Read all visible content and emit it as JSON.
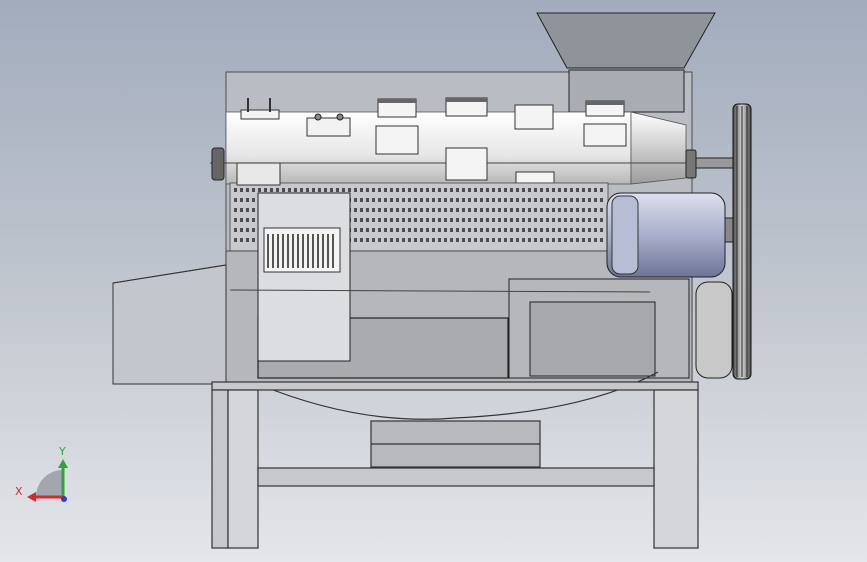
{
  "triad": {
    "x_label": "X",
    "y_label": "Y",
    "x_color": "#d62a2a",
    "y_color": "#2ea53a",
    "z_color": "#2a3fd6"
  },
  "colors": {
    "background_top": "#a2acbd",
    "background_bottom": "#e4e6ea",
    "line": "#2a2a2a",
    "panel_gray": "#b7b9be",
    "light_panel": "#e6e7ea",
    "motor_blue": "#aeb4d0",
    "rotor": "#e8e8e8"
  }
}
